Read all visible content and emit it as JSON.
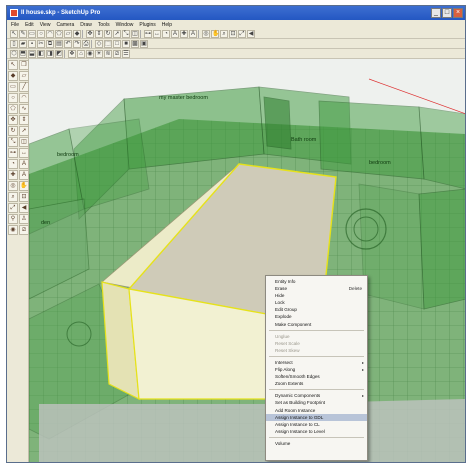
{
  "window": {
    "title": "Il house.skp - SketchUp Pro",
    "min": "_",
    "max": "□",
    "close": "×"
  },
  "menu": [
    "File",
    "Edit",
    "View",
    "Camera",
    "Draw",
    "Tools",
    "Window",
    "Plugins",
    "Help"
  ],
  "scene": {
    "labels": [
      {
        "text": "my master bedroom"
      },
      {
        "text": "bedroom"
      },
      {
        "text": "den"
      },
      {
        "text": "Bath room"
      },
      {
        "text": "bedroom"
      }
    ]
  },
  "context_menu": {
    "items": [
      {
        "label": "Entity Info",
        "shortcut": "",
        "disabled": false,
        "submenu": false,
        "separator_before": false
      },
      {
        "label": "Erase",
        "shortcut": "Delete",
        "disabled": false,
        "submenu": false,
        "separator_before": false
      },
      {
        "label": "Hide",
        "shortcut": "",
        "disabled": false,
        "submenu": false,
        "separator_before": false
      },
      {
        "label": "Lock",
        "shortcut": "",
        "disabled": false,
        "submenu": false,
        "separator_before": false
      },
      {
        "label": "Edit Group",
        "shortcut": "",
        "disabled": false,
        "submenu": false,
        "separator_before": false
      },
      {
        "label": "Explode",
        "shortcut": "",
        "disabled": false,
        "submenu": false,
        "separator_before": false
      },
      {
        "label": "Make Component",
        "shortcut": "",
        "disabled": false,
        "submenu": false,
        "separator_before": false
      },
      {
        "label": "Unglue",
        "shortcut": "",
        "disabled": true,
        "submenu": false,
        "separator_before": true
      },
      {
        "label": "Reset Scale",
        "shortcut": "",
        "disabled": true,
        "submenu": false,
        "separator_before": false
      },
      {
        "label": "Reset Skew",
        "shortcut": "",
        "disabled": true,
        "submenu": false,
        "separator_before": false
      },
      {
        "label": "Intersect",
        "shortcut": "",
        "disabled": false,
        "submenu": true,
        "separator_before": true
      },
      {
        "label": "Flip Along",
        "shortcut": "",
        "disabled": false,
        "submenu": true,
        "separator_before": false
      },
      {
        "label": "Soften/Smooth Edges",
        "shortcut": "",
        "disabled": false,
        "submenu": false,
        "separator_before": false
      },
      {
        "label": "Zoom Extents",
        "shortcut": "",
        "disabled": false,
        "submenu": false,
        "separator_before": false
      },
      {
        "label": "Dynamic Components",
        "shortcut": "",
        "disabled": false,
        "submenu": true,
        "separator_before": true
      },
      {
        "label": "Set as Building Footprint",
        "shortcut": "",
        "disabled": false,
        "submenu": false,
        "separator_before": false
      },
      {
        "label": "Add Room Instance",
        "shortcut": "",
        "disabled": false,
        "submenu": false,
        "separator_before": false
      },
      {
        "label": "Assign Instance to GDL",
        "shortcut": "",
        "disabled": false,
        "submenu": false,
        "separator_before": false,
        "highlight": true
      },
      {
        "label": "Assign Instance to CL",
        "shortcut": "",
        "disabled": false,
        "submenu": false,
        "separator_before": false
      },
      {
        "label": "Assign Instance to Level",
        "shortcut": "",
        "disabled": false,
        "submenu": false,
        "separator_before": false
      },
      {
        "label": "Volume",
        "shortcut": "",
        "disabled": false,
        "submenu": false,
        "separator_before": true
      }
    ]
  },
  "colors": {
    "glass_green": "#3e9a3e",
    "selected_box_top": "#cfcbb8",
    "selected_box_side": "#ecebc8",
    "selection_edge": "#e6e21a",
    "menu_highlight": "#b8c4d8"
  }
}
